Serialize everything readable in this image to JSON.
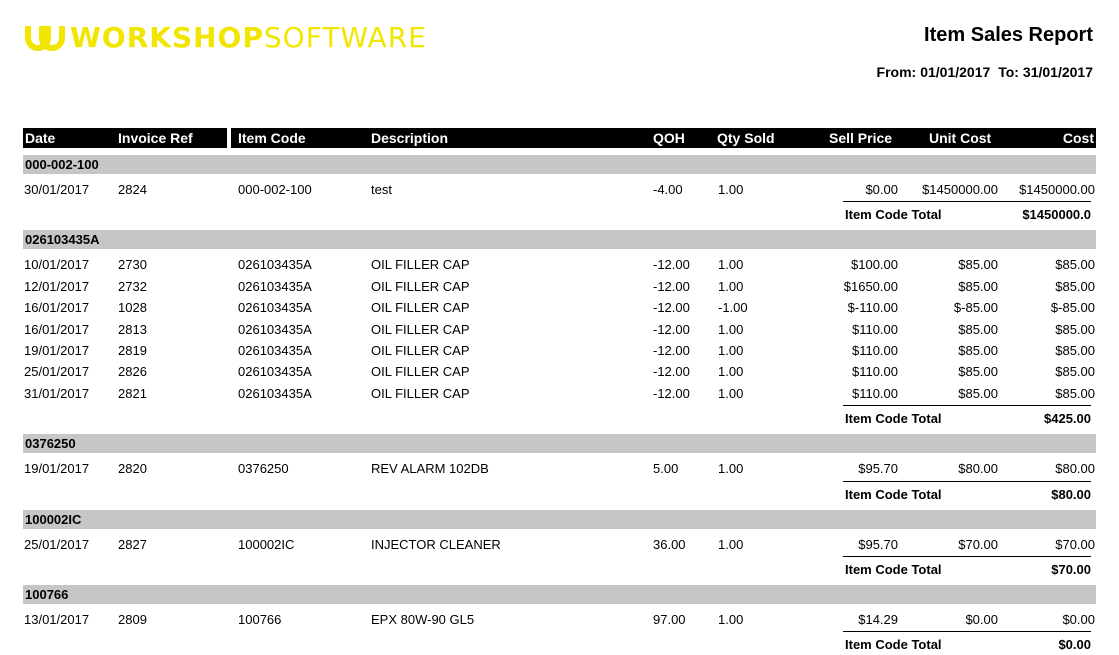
{
  "brand": {
    "bold": "WORKSHOP",
    "light": "SOFTWARE",
    "color": "#f2e600"
  },
  "report": {
    "title": "Item Sales Report",
    "from_label": "From:",
    "from_date": "01/01/2017",
    "to_label": "To:",
    "to_date": "31/01/2017"
  },
  "columns": {
    "date": "Date",
    "invoice_ref": "Invoice Ref",
    "item_code": "Item Code",
    "description": "Description",
    "qoh": "QOH",
    "qty_sold": "Qty Sold",
    "sell_price": "Sell Price",
    "unit_cost": "Unit Cost",
    "cost": "Cost"
  },
  "total_label": "Item Code Total",
  "groups": [
    {
      "code": "000-002-100",
      "rows": [
        {
          "date": "30/01/2017",
          "invoice": "2824",
          "item": "000-002-100",
          "desc": "test",
          "qoh": "-4.00",
          "qty": "1.00",
          "sell": "$0.00",
          "unit": "$1450000.00",
          "cost": "$1450000.00"
        }
      ],
      "total": "$1450000.0"
    },
    {
      "code": "026103435A",
      "rows": [
        {
          "date": "10/01/2017",
          "invoice": "2730",
          "item": "026103435A",
          "desc": "OIL FILLER CAP",
          "qoh": "-12.00",
          "qty": "1.00",
          "sell": "$100.00",
          "unit": "$85.00",
          "cost": "$85.00"
        },
        {
          "date": "12/01/2017",
          "invoice": "2732",
          "item": "026103435A",
          "desc": "OIL FILLER CAP",
          "qoh": "-12.00",
          "qty": "1.00",
          "sell": "$1650.00",
          "unit": "$85.00",
          "cost": "$85.00"
        },
        {
          "date": "16/01/2017",
          "invoice": "1028",
          "item": "026103435A",
          "desc": "OIL FILLER CAP",
          "qoh": "-12.00",
          "qty": "-1.00",
          "sell": "$-110.00",
          "unit": "$-85.00",
          "cost": "$-85.00"
        },
        {
          "date": "16/01/2017",
          "invoice": "2813",
          "item": "026103435A",
          "desc": "OIL FILLER CAP",
          "qoh": "-12.00",
          "qty": "1.00",
          "sell": "$110.00",
          "unit": "$85.00",
          "cost": "$85.00"
        },
        {
          "date": "19/01/2017",
          "invoice": "2819",
          "item": "026103435A",
          "desc": "OIL FILLER CAP",
          "qoh": "-12.00",
          "qty": "1.00",
          "sell": "$110.00",
          "unit": "$85.00",
          "cost": "$85.00"
        },
        {
          "date": "25/01/2017",
          "invoice": "2826",
          "item": "026103435A",
          "desc": "OIL FILLER CAP",
          "qoh": "-12.00",
          "qty": "1.00",
          "sell": "$110.00",
          "unit": "$85.00",
          "cost": "$85.00"
        },
        {
          "date": "31/01/2017",
          "invoice": "2821",
          "item": "026103435A",
          "desc": "OIL FILLER CAP",
          "qoh": "-12.00",
          "qty": "1.00",
          "sell": "$110.00",
          "unit": "$85.00",
          "cost": "$85.00"
        }
      ],
      "total": "$425.00"
    },
    {
      "code": "0376250",
      "rows": [
        {
          "date": "19/01/2017",
          "invoice": "2820",
          "item": "0376250",
          "desc": "REV ALARM 102DB",
          "qoh": "5.00",
          "qty": "1.00",
          "sell": "$95.70",
          "unit": "$80.00",
          "cost": "$80.00"
        }
      ],
      "total": "$80.00"
    },
    {
      "code": "100002IC",
      "rows": [
        {
          "date": "25/01/2017",
          "invoice": "2827",
          "item": "100002IC",
          "desc": "INJECTOR CLEANER",
          "qoh": "36.00",
          "qty": "1.00",
          "sell": "$95.70",
          "unit": "$70.00",
          "cost": "$70.00"
        }
      ],
      "total": "$70.00"
    },
    {
      "code": "100766",
      "rows": [
        {
          "date": "13/01/2017",
          "invoice": "2809",
          "item": "100766",
          "desc": "EPX 80W-90 GL5",
          "qoh": "97.00",
          "qty": "1.00",
          "sell": "$14.29",
          "unit": "$0.00",
          "cost": "$0.00"
        }
      ],
      "total": "$0.00"
    }
  ]
}
